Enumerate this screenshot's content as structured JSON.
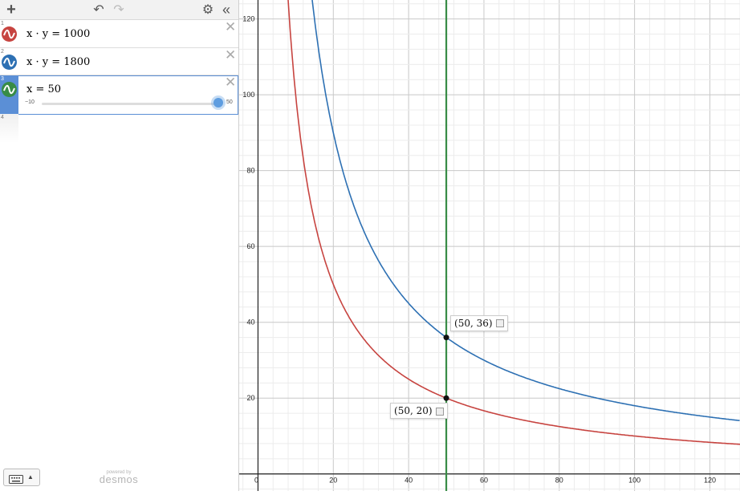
{
  "toolbar": {
    "add_label": "+",
    "undo_label": "↶",
    "redo_label": "↷",
    "settings_label": "⚙",
    "collapse_label": "«"
  },
  "expressions": [
    {
      "index": "1",
      "latex": "x · y = 1000",
      "color": "#c74440",
      "icon": "wave-icon"
    },
    {
      "index": "2",
      "latex": "x · y = 1800",
      "color": "#2d70b3",
      "icon": "wave-icon"
    },
    {
      "index": "3",
      "latex": "x  =  50",
      "color": "#388c46",
      "icon": "wave-icon",
      "slider": {
        "min": "−10",
        "max": "50",
        "value": 50
      }
    }
  ],
  "empty_row_index": "4",
  "keyboard": {
    "icon": "keyboard-icon",
    "caret": "▲"
  },
  "brand": {
    "small": "powered by",
    "big": "desmos"
  },
  "graph": {
    "x_ticks": [
      "0",
      "20",
      "40",
      "60",
      "80",
      "100",
      "120"
    ],
    "y_ticks": [
      "20",
      "40",
      "60",
      "80",
      "100",
      "120"
    ],
    "xlim": [
      -5,
      128
    ],
    "ylim": [
      -4.5,
      125
    ],
    "grid": true,
    "curves": [
      {
        "name": "x · y = 1000",
        "k": 1000,
        "color": "#c74440"
      },
      {
        "name": "x · y = 1800",
        "k": 1800,
        "color": "#2d70b3"
      }
    ],
    "vline": {
      "x": 50,
      "color": "#388c46"
    },
    "points": [
      {
        "x": 50,
        "y": 36,
        "label": "(50, 36)"
      },
      {
        "x": 50,
        "y": 20,
        "label": "(50, 20)"
      }
    ]
  }
}
